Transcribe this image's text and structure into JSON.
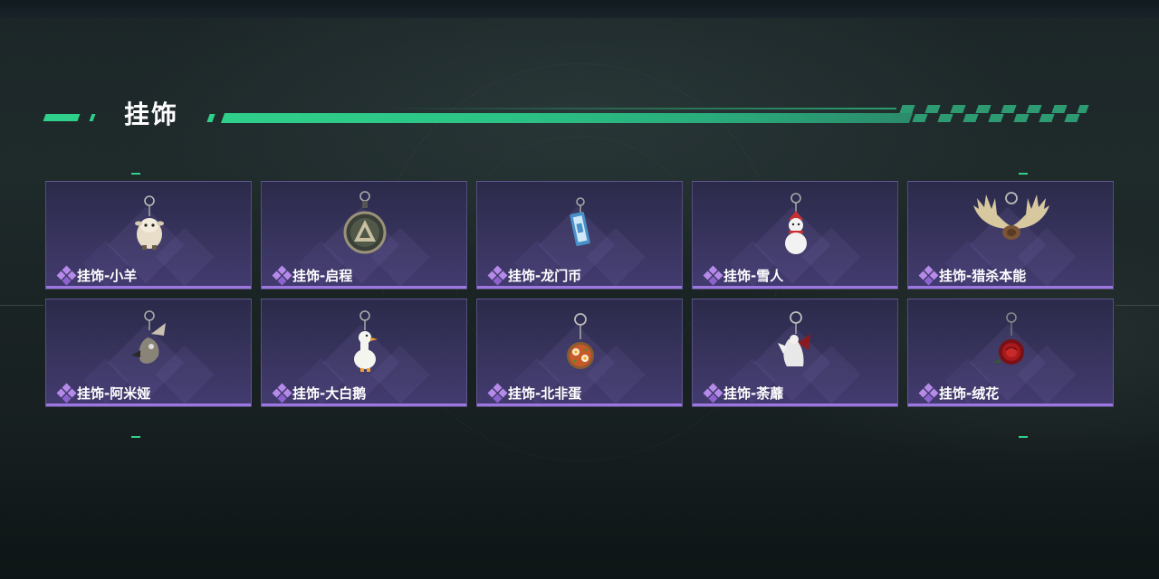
{
  "section": {
    "title": "挂饰",
    "accent_color": "#2fd08a"
  },
  "rarity_color": "#9d77e0",
  "items": [
    {
      "label": "挂饰-小羊",
      "icon": "lamb-charm-icon"
    },
    {
      "label": "挂饰-启程",
      "icon": "medallion-charm-icon"
    },
    {
      "label": "挂饰-龙门币",
      "icon": "coin-card-charm-icon"
    },
    {
      "label": "挂饰-雪人",
      "icon": "snowman-charm-icon"
    },
    {
      "label": "挂饰-猎杀本能",
      "icon": "antler-charm-icon"
    },
    {
      "label": "挂饰-阿米娅",
      "icon": "amiya-charm-icon"
    },
    {
      "label": "挂饰-大白鹅",
      "icon": "goose-charm-icon"
    },
    {
      "label": "挂饰-北非蛋",
      "icon": "shakshuka-charm-icon"
    },
    {
      "label": "挂饰-荼蘼",
      "icon": "winged-figure-charm-icon"
    },
    {
      "label": "挂饰-绒花",
      "icon": "rose-charm-icon"
    }
  ]
}
